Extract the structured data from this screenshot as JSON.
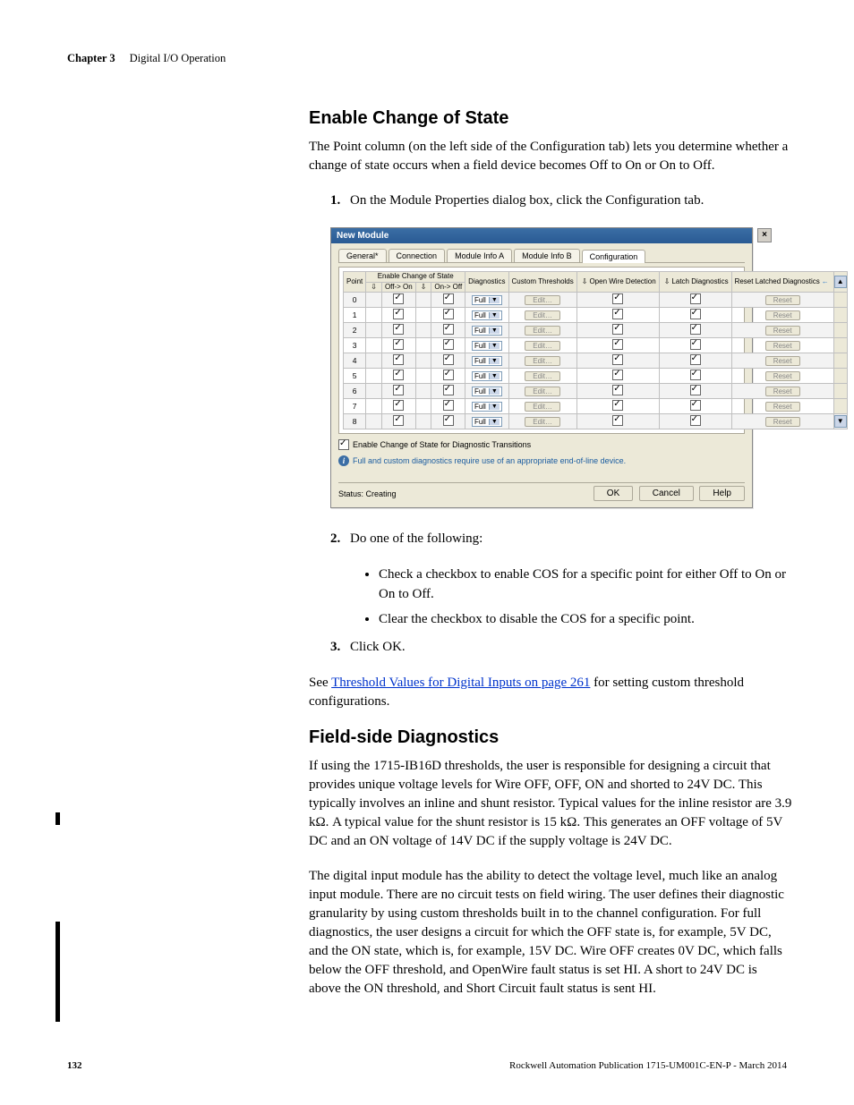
{
  "header": {
    "chapter_label": "Chapter 3",
    "chapter_title": "Digital I/O Operation"
  },
  "section1": {
    "heading": "Enable Change of State",
    "intro": "The Point column (on the left side of the Configuration tab) lets you determine whether a change of state occurs when a field device becomes Off to On or On to Off.",
    "step1_num": "1.",
    "step1": "On the Module Properties dialog box, click the Configuration tab."
  },
  "dialog": {
    "title": "New Module",
    "close_glyph": "×",
    "tabs": [
      "General*",
      "Connection",
      "Module Info A",
      "Module Info B",
      "Configuration"
    ],
    "headers": {
      "point": "Point",
      "cos_group": "Enable Change of State",
      "off_on": "Off->\nOn",
      "on_off": "On->\nOff",
      "diagnostics": "Diagnostics",
      "custom_thresholds": "Custom\nThresholds",
      "open_wire": "Open Wire\nDetection",
      "latch": "Latch\nDiagnostics",
      "reset": "Reset\nLatched\nDiagnostics"
    },
    "rows": [
      {
        "point": "0",
        "off_on": true,
        "on_off": true,
        "diag": "Full",
        "edit": "Edit…",
        "open": true,
        "latch": true,
        "reset": "Reset"
      },
      {
        "point": "1",
        "off_on": true,
        "on_off": true,
        "diag": "Full",
        "edit": "Edit…",
        "open": true,
        "latch": true,
        "reset": "Reset"
      },
      {
        "point": "2",
        "off_on": true,
        "on_off": true,
        "diag": "Full",
        "edit": "Edit…",
        "open": true,
        "latch": true,
        "reset": "Reset"
      },
      {
        "point": "3",
        "off_on": true,
        "on_off": true,
        "diag": "Full",
        "edit": "Edit…",
        "open": true,
        "latch": true,
        "reset": "Reset"
      },
      {
        "point": "4",
        "off_on": true,
        "on_off": true,
        "diag": "Full",
        "edit": "Edit…",
        "open": true,
        "latch": true,
        "reset": "Reset"
      },
      {
        "point": "5",
        "off_on": true,
        "on_off": true,
        "diag": "Full",
        "edit": "Edit…",
        "open": true,
        "latch": true,
        "reset": "Reset"
      },
      {
        "point": "6",
        "off_on": true,
        "on_off": true,
        "diag": "Full",
        "edit": "Edit…",
        "open": true,
        "latch": true,
        "reset": "Reset"
      },
      {
        "point": "7",
        "off_on": true,
        "on_off": true,
        "diag": "Full",
        "edit": "Edit…",
        "open": true,
        "latch": true,
        "reset": "Reset"
      },
      {
        "point": "8",
        "off_on": true,
        "on_off": true,
        "diag": "Full",
        "edit": "Edit…",
        "open": true,
        "latch": true,
        "reset": "Reset"
      }
    ],
    "cos_diag_checked": true,
    "cos_diag_label": "Enable Change of State for Diagnostic Transitions",
    "info_note": "Full and custom diagnostics require use of an appropriate end-of-line device.",
    "status_label": "Status:",
    "status_value": "Creating",
    "buttons": {
      "ok": "OK",
      "cancel": "Cancel",
      "help": "Help"
    }
  },
  "section1b": {
    "step2_num": "2.",
    "step2": "Do one of the following:",
    "sub1": "Check a checkbox to enable COS for a specific point for either Off to On or On to Off.",
    "sub2": "Clear the checkbox to disable the COS for a specific point.",
    "step3_num": "3.",
    "step3": "Click OK.",
    "see_pre": "See ",
    "see_link": "Threshold Values for Digital Inputs on page 261",
    "see_post": " for setting custom threshold configurations."
  },
  "section2": {
    "heading": "Field-side Diagnostics",
    "p1": "If using the 1715-IB16D thresholds, the user is responsible for designing a circuit that provides unique voltage levels for Wire OFF, OFF, ON and shorted to 24V DC. This typically involves an inline and shunt resistor. Typical values for the inline resistor are 3.9 kΩ. A typical value for the shunt resistor is 15 kΩ. This generates an OFF voltage of 5V DC and an ON voltage of 14V DC if the supply voltage is 24V DC.",
    "p2": "The digital input module has the ability to detect the voltage level, much like an analog input module. There are no circuit tests on field wiring. The user defines their diagnostic granularity by using custom thresholds built in to the channel configuration. For full diagnostics, the user designs a circuit for which the OFF state is, for example, 5V DC, and the ON state, which is, for example, 15V DC. Wire OFF creates 0V DC, which falls below the OFF threshold, and OpenWire fault status is set HI. A short to 24V DC is above the ON threshold, and Short Circuit fault status is sent HI."
  },
  "footer": {
    "pagenum": "132",
    "pub": "Rockwell Automation Publication 1715-UM001C-EN-P - March 2014"
  }
}
